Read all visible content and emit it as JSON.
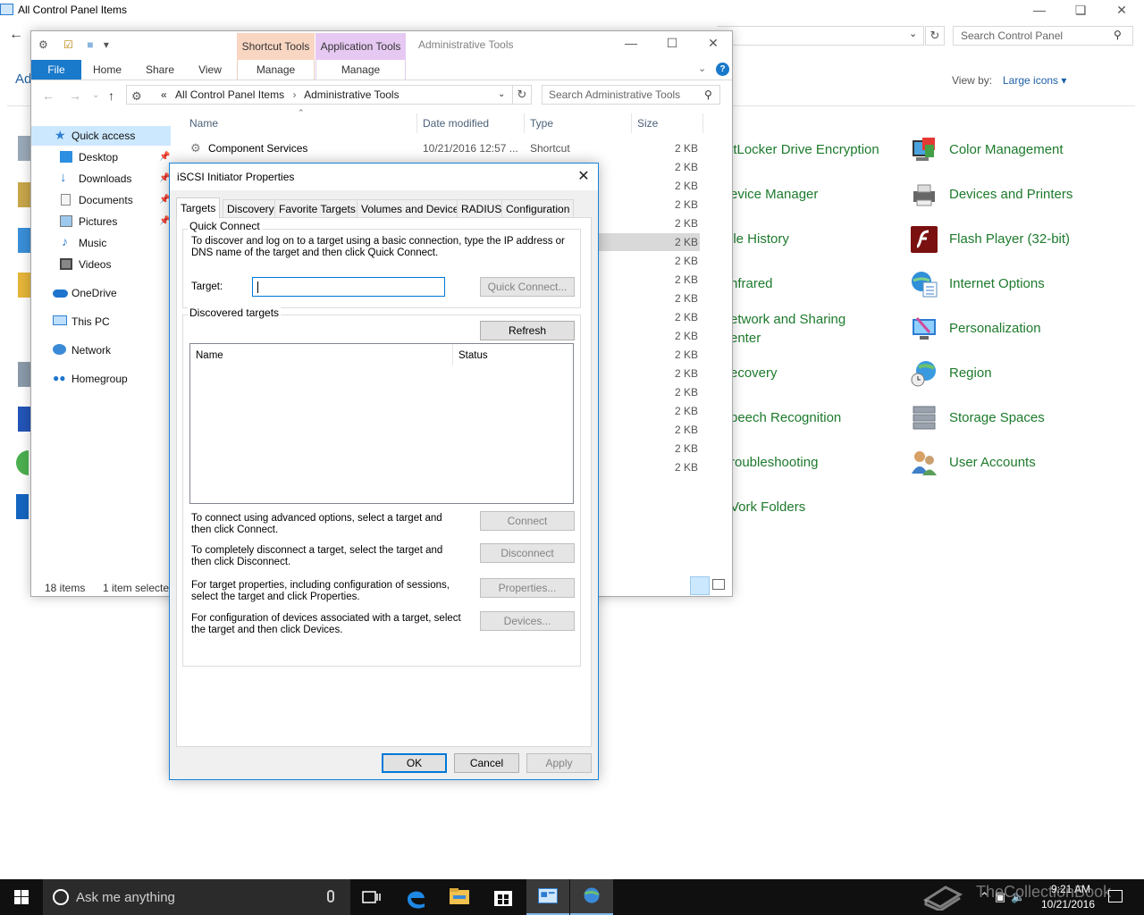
{
  "control_panel": {
    "title": "All Control Panel Items",
    "search_placeholder": "Search Control Panel",
    "heading_partial": "Ad",
    "view_by_label": "View by:",
    "view_by_value": "Large icons ▾",
    "items_col1": [
      {
        "label": "itLocker Drive Encryption"
      },
      {
        "label": "evice Manager"
      },
      {
        "label": "ile History"
      },
      {
        "label": "nfrared"
      },
      {
        "label": "etwork and Sharing"
      },
      {
        "label": "enter"
      },
      {
        "label": "ecovery"
      },
      {
        "label": "peech Recognition"
      },
      {
        "label": "roubleshooting"
      },
      {
        "label": "Vork Folders"
      }
    ],
    "items_col2": [
      {
        "label": "Color Management",
        "icon": "color-management-icon"
      },
      {
        "label": "Devices and Printers",
        "icon": "printer-icon"
      },
      {
        "label": "Flash Player (32-bit)",
        "icon": "flash-icon"
      },
      {
        "label": "Internet Options",
        "icon": "globe-checklist-icon"
      },
      {
        "label": "Personalization",
        "icon": "monitor-brush-icon"
      },
      {
        "label": "Region",
        "icon": "globe-clock-icon"
      },
      {
        "label": "Storage Spaces",
        "icon": "storage-drives-icon"
      },
      {
        "label": "User Accounts",
        "icon": "users-icon"
      }
    ]
  },
  "explorer": {
    "title": "Administrative Tools",
    "ribbon": {
      "contextual_shortcut": "Shortcut Tools",
      "contextual_app": "Application Tools",
      "tabs": [
        "File",
        "Home",
        "Share",
        "View"
      ],
      "manage_1": "Manage",
      "manage_2": "Manage"
    },
    "address": {
      "prefix": "«",
      "crumb1": "All Control Panel Items",
      "crumb2": "Administrative Tools"
    },
    "search_placeholder": "Search Administrative Tools",
    "nav_pane": [
      {
        "label": "Quick access",
        "icon": "star-icon",
        "pinned": false
      },
      {
        "label": "Desktop",
        "icon": "desktop-icon",
        "pinned": true
      },
      {
        "label": "Downloads",
        "icon": "download-icon",
        "pinned": true
      },
      {
        "label": "Documents",
        "icon": "documents-icon",
        "pinned": true
      },
      {
        "label": "Pictures",
        "icon": "pictures-icon",
        "pinned": true
      },
      {
        "label": "Music",
        "icon": "music-icon",
        "pinned": false
      },
      {
        "label": "Videos",
        "icon": "videos-icon",
        "pinned": false
      },
      {
        "label": "OneDrive",
        "icon": "cloud-icon",
        "pinned": false
      },
      {
        "label": "This PC",
        "icon": "computer-icon",
        "pinned": false
      },
      {
        "label": "Network",
        "icon": "network-icon",
        "pinned": false
      },
      {
        "label": "Homegroup",
        "icon": "homegroup-icon",
        "pinned": false
      }
    ],
    "columns": [
      "Name",
      "Date modified",
      "Type",
      "Size"
    ],
    "first_row": {
      "name": "Component Services",
      "date": "10/21/2016 12:57 ...",
      "type": "Shortcut",
      "size": "2 KB"
    },
    "sizes": [
      "2 KB",
      "2 KB",
      "2 KB",
      "2 KB",
      "2 KB",
      "2 KB",
      "2 KB",
      "2 KB",
      "2 KB",
      "2 KB",
      "2 KB",
      "2 KB",
      "2 KB",
      "2 KB",
      "2 KB",
      "2 KB",
      "2 KB",
      "2 KB"
    ],
    "status_items": "18 items",
    "status_selected": "1 item selected"
  },
  "dialog": {
    "title": "iSCSI Initiator Properties",
    "tabs": [
      "Targets",
      "Discovery",
      "Favorite Targets",
      "Volumes and Devices",
      "RADIUS",
      "Configuration"
    ],
    "quick_connect": {
      "group_label": "Quick Connect",
      "description": "To discover and log on to a target using a basic connection, type the IP address or DNS name of the target and then click Quick Connect.",
      "target_label": "Target:",
      "target_value": "",
      "button": "Quick Connect..."
    },
    "discovered": {
      "group_label": "Discovered targets",
      "refresh": "Refresh",
      "col_name": "Name",
      "col_status": "Status"
    },
    "actions": [
      {
        "text": "To connect using advanced options, select a target and then click Connect.",
        "button": "Connect"
      },
      {
        "text": "To completely disconnect a target, select the target and then click Disconnect.",
        "button": "Disconnect"
      },
      {
        "text": "For target properties, including configuration of sessions, select the target and click Properties.",
        "button": "Properties..."
      },
      {
        "text": "For configuration of devices associated with a target, select the target and then click Devices.",
        "button": "Devices..."
      }
    ],
    "ok": "OK",
    "cancel": "Cancel",
    "apply": "Apply"
  },
  "taskbar": {
    "search_text": "Ask me anything",
    "time": "9:21 AM",
    "date": "10/21/2016",
    "watermark": "TheCollectionBook"
  }
}
